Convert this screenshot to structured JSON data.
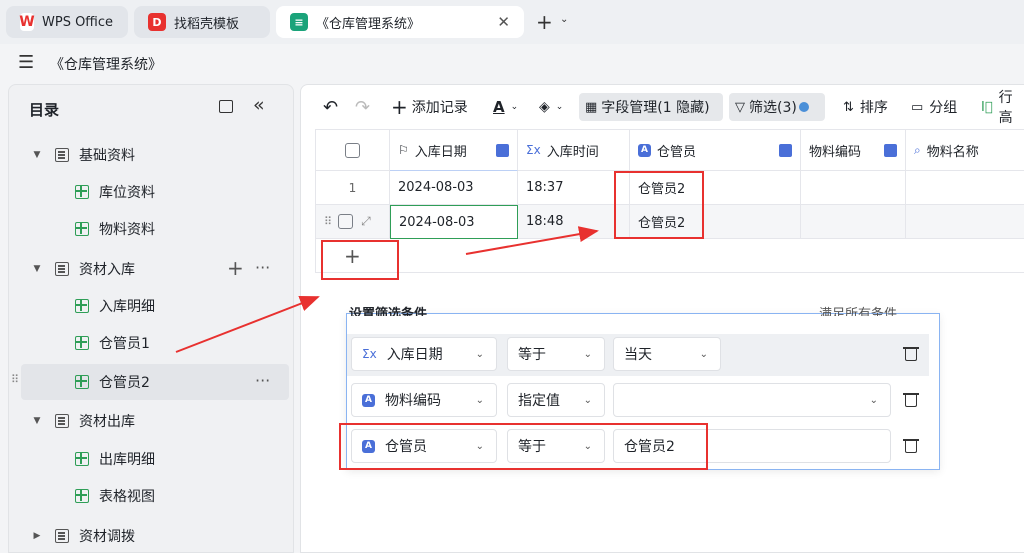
{
  "tabs": [
    {
      "label": "WPS Office"
    },
    {
      "label": "找稻壳模板"
    },
    {
      "label": "《仓库管理系统》"
    }
  ],
  "doc_title": "《仓库管理系统》",
  "sidebar": {
    "title": "目录",
    "items": [
      {
        "label": "基础资料"
      },
      {
        "label": "库位资料"
      },
      {
        "label": "物料资料"
      },
      {
        "label": "资材入库"
      },
      {
        "label": "入库明细"
      },
      {
        "label": "仓管员1"
      },
      {
        "label": "仓管员2"
      },
      {
        "label": "资材出库"
      },
      {
        "label": "出库明细"
      },
      {
        "label": "表格视图"
      },
      {
        "label": "资材调拨"
      }
    ]
  },
  "toolbar": {
    "add_record": "添加记录",
    "field_manage": "字段管理(1 隐藏)",
    "filter": "筛选(3)",
    "sort": "排序",
    "group": "分组",
    "row_height": "行高"
  },
  "grid": {
    "columns": [
      "入库日期",
      "入库时间",
      "仓管员",
      "物料编码",
      "物料名称"
    ],
    "rows": [
      {
        "num": "1",
        "date": "2024-08-03",
        "time": "18:37",
        "keeper": "仓管员2"
      },
      {
        "num": "",
        "date": "2024-08-03",
        "time": "18:48",
        "keeper": "仓管员2"
      }
    ]
  },
  "filter_panel": {
    "title": "设置筛选条件",
    "match_all": "满足所有条件",
    "conditions": [
      {
        "field": "入库日期",
        "op": "等于",
        "value": "当天"
      },
      {
        "field": "物料编码",
        "op": "指定值",
        "value": ""
      },
      {
        "field": "仓管员",
        "op": "等于",
        "value": "仓管员2"
      }
    ]
  },
  "colors": {
    "annotation": "#e8312f",
    "accent": "#4a6fd8",
    "panel_border": "#8ab4f2"
  }
}
